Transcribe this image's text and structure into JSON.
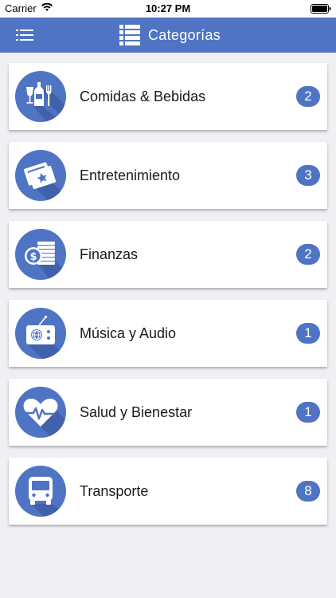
{
  "status_bar": {
    "carrier": "Carrier",
    "time": "10:27 PM"
  },
  "nav": {
    "title": "Categorías",
    "menu_icon": "menu-icon",
    "title_icon": "list-icon"
  },
  "categories": [
    {
      "label": "Comidas & Bebidas",
      "count": "2",
      "icon": "food-drink-icon"
    },
    {
      "label": "Entretenimiento",
      "count": "3",
      "icon": "tickets-icon"
    },
    {
      "label": "Finanzas",
      "count": "2",
      "icon": "money-icon"
    },
    {
      "label": "Música y Audio",
      "count": "1",
      "icon": "radio-icon"
    },
    {
      "label": "Salud y Bienestar",
      "count": "1",
      "icon": "heart-icon"
    },
    {
      "label": "Transporte",
      "count": "8",
      "icon": "bus-icon"
    }
  ],
  "colors": {
    "accent": "#4f74c4",
    "background": "#efeff4",
    "card": "#ffffff"
  }
}
